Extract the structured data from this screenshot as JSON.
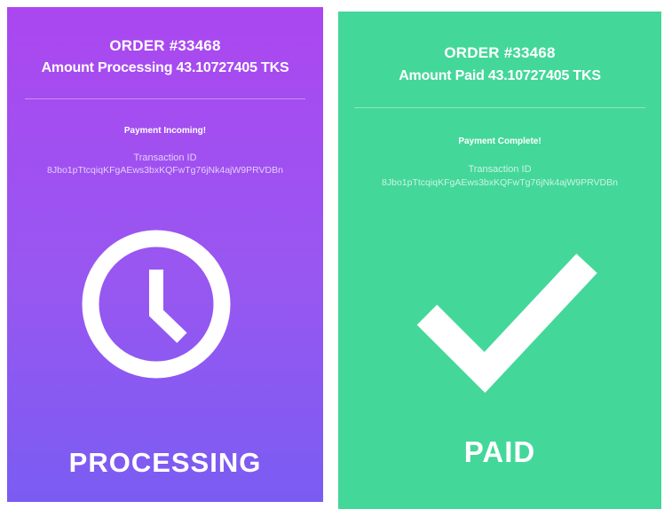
{
  "processing": {
    "order": "ORDER #33468",
    "amount": "Amount Processing 43.10727405 TKS",
    "message": "Payment Incoming!",
    "transaction_label": "Transaction ID",
    "transaction_id": "8Jbo1pTtcqiqKFgAEws3bxKQFwTg76jNk4ajW9PRVDBn",
    "status": "PROCESSING",
    "icon": "clock-icon",
    "color": "#9d50f1"
  },
  "paid": {
    "order": "ORDER #33468",
    "amount": "Amount Paid 43.10727405 TKS",
    "message": "Payment Complete!",
    "transaction_label": "Transaction ID",
    "transaction_id": "8Jbo1pTtcqiqKFgAEws3bxKQFwTg76jNk4ajW9PRVDBn",
    "status": "PAID",
    "icon": "checkmark-icon",
    "color": "#44d79a"
  }
}
